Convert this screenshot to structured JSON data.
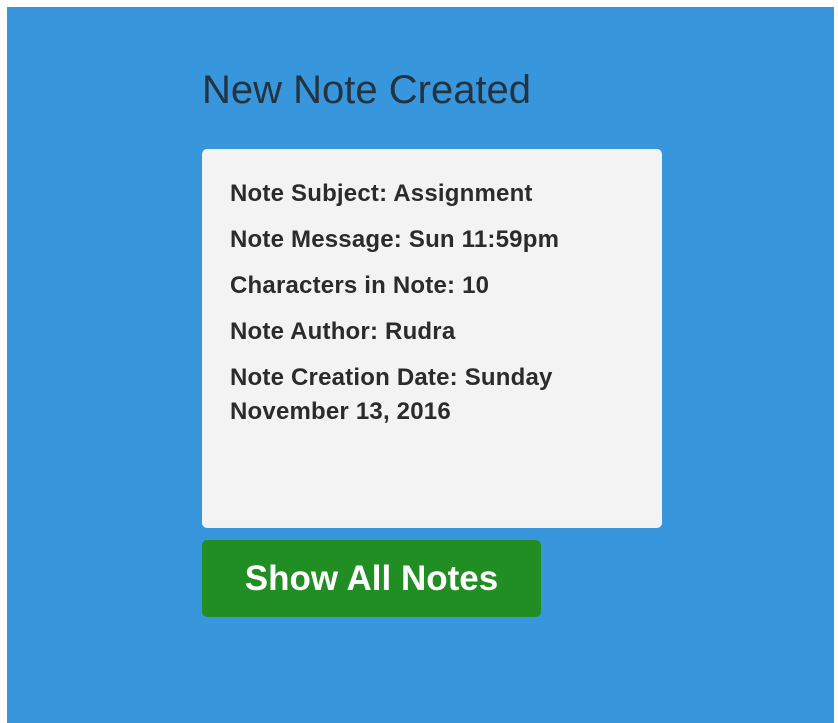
{
  "page": {
    "title": "New Note Created"
  },
  "note": {
    "subject": {
      "label": "Note Subject:",
      "value": "Assignment"
    },
    "message": {
      "label": "Note Message:",
      "value": "Sun 11:59pm"
    },
    "characters": {
      "label": "Characters in Note:",
      "value": "10"
    },
    "author": {
      "label": "Note Author:",
      "value": "Rudra"
    },
    "creation_date": {
      "label": "Note Creation Date:",
      "value": "Sunday November 13, 2016"
    }
  },
  "actions": {
    "show_all_label": "Show All Notes"
  },
  "colors": {
    "background": "#3897dc",
    "card": "#f3f3f3",
    "title_text": "#243342",
    "button": "#208e23",
    "button_text": "#ffffff"
  }
}
